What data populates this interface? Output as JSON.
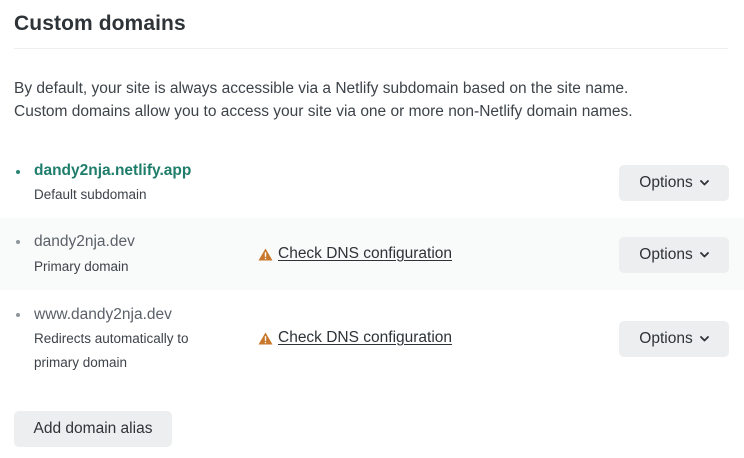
{
  "section": {
    "title": "Custom domains",
    "description": [
      "By default, your site is always accessible via a Netlify subdomain based on the site name.",
      "Custom domains allow you to access your site via one or more non-Netlify domain names."
    ]
  },
  "domains": [
    {
      "name": "dandy2nja.netlify.app",
      "subtitle": "Default subdomain",
      "warning": "",
      "options_label": "Options"
    },
    {
      "name": "dandy2nja.dev",
      "subtitle": "Primary domain",
      "warning": "Check DNS configuration",
      "options_label": "Options"
    },
    {
      "name": "www.dandy2nja.dev",
      "subtitle": "Redirects automatically to primary domain",
      "warning": "Check DNS configuration",
      "options_label": "Options"
    }
  ],
  "actions": {
    "add_alias_label": "Add domain alias"
  },
  "colors": {
    "link_teal": "#1f7d6b",
    "warning_orange": "#c8772b",
    "button_gray": "#eceeef",
    "row_shade": "#f9fafa"
  },
  "icons": [
    "warning-icon",
    "chevron-down-icon",
    "bullet-icon"
  ]
}
